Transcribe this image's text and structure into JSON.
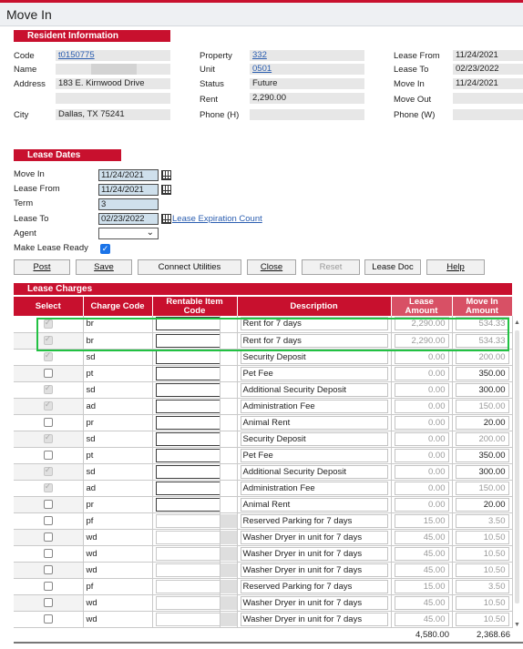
{
  "window": {
    "title": "Move In"
  },
  "resident": {
    "section": "Resident Information",
    "code_label": "Code",
    "code": "t0150775",
    "name_label": "Name",
    "address_label": "Address",
    "address": "183 E. Kirnwood Drive",
    "city_label": "City",
    "city": "Dallas, TX 75241",
    "property_label": "Property",
    "property": "332",
    "unit_label": "Unit",
    "unit": "0501",
    "status_label": "Status",
    "status": "Future",
    "rent_label": "Rent",
    "rent": "2,290.00",
    "phone_h_label": "Phone (H)",
    "lease_from_label": "Lease From",
    "lease_from": "11/24/2021",
    "lease_to_label": "Lease To",
    "lease_to": "02/23/2022",
    "move_in_label": "Move In",
    "move_in": "11/24/2021",
    "move_out_label": "Move Out",
    "phone_w_label": "Phone (W)"
  },
  "lease_dates": {
    "section": "Lease Dates",
    "move_in_label": "Move In",
    "move_in": "11/24/2021",
    "lease_from_label": "Lease From",
    "lease_from": "11/24/2021",
    "term_label": "Term",
    "term": "3",
    "lease_to_label": "Lease To",
    "lease_to": "02/23/2022",
    "expiration_link": "Lease Expiration Count",
    "agent_label": "Agent",
    "ready_label": "Make Lease Ready"
  },
  "buttons": {
    "post": "Post",
    "save": "Save",
    "connect": "Connect Utilities",
    "close": "Close",
    "reset": "Reset",
    "lease_doc": "Lease Doc",
    "help": "Help"
  },
  "charges": {
    "section": "Lease Charges",
    "headers": {
      "select": "Select",
      "code": "Charge Code",
      "ric": "Rentable Item Code",
      "desc": "Description",
      "lease": "Lease Amount",
      "movein": "Move In Amount"
    },
    "rows": [
      {
        "code": "br",
        "desc": "Rent for 7 days",
        "lease": "2,290.00",
        "movein": "534.33"
      },
      {
        "code": "br",
        "desc": "Rent for 7 days",
        "lease": "2,290.00",
        "movein": "534.33"
      },
      {
        "code": "sd",
        "desc": "Security Deposit",
        "lease": "0.00",
        "movein": "200.00"
      },
      {
        "code": "pt",
        "desc": "Pet Fee",
        "lease": "0.00",
        "movein": "350.00"
      },
      {
        "code": "sd",
        "desc": "Additional Security Deposit",
        "lease": "0.00",
        "movein": "300.00"
      },
      {
        "code": "ad",
        "desc": "Administration Fee",
        "lease": "0.00",
        "movein": "150.00"
      },
      {
        "code": "pr",
        "desc": "Animal Rent",
        "lease": "0.00",
        "movein": "20.00"
      },
      {
        "code": "sd",
        "desc": "Security Deposit",
        "lease": "0.00",
        "movein": "200.00"
      },
      {
        "code": "pt",
        "desc": "Pet Fee",
        "lease": "0.00",
        "movein": "350.00"
      },
      {
        "code": "sd",
        "desc": "Additional Security Deposit",
        "lease": "0.00",
        "movein": "300.00"
      },
      {
        "code": "ad",
        "desc": "Administration Fee",
        "lease": "0.00",
        "movein": "150.00"
      },
      {
        "code": "pr",
        "desc": "Animal Rent",
        "lease": "0.00",
        "movein": "20.00"
      },
      {
        "code": "pf",
        "desc": "Reserved Parking for 7 days",
        "lease": "15.00",
        "movein": "3.50"
      },
      {
        "code": "wd",
        "desc": "Washer Dryer in unit for 7 days",
        "lease": "45.00",
        "movein": "10.50"
      },
      {
        "code": "wd",
        "desc": "Washer Dryer in  unit for 7 days",
        "lease": "45.00",
        "movein": "10.50"
      },
      {
        "code": "wd",
        "desc": "Washer Dryer in unit for 7 days",
        "lease": "45.00",
        "movein": "10.50"
      },
      {
        "code": "pf",
        "desc": "Reserved Parking for 7 days",
        "lease": "15.00",
        "movein": "3.50"
      },
      {
        "code": "wd",
        "desc": "Washer Dryer in unit for 7 days",
        "lease": "45.00",
        "movein": "10.50"
      },
      {
        "code": "wd",
        "desc": "Washer Dryer in  unit for 7 days",
        "lease": "45.00",
        "movein": "10.50"
      }
    ],
    "total_lease": "4,580.00",
    "total_movein": "2,368.66"
  },
  "colors": {
    "accent": "#c8102e",
    "highlight": "#22c143"
  }
}
